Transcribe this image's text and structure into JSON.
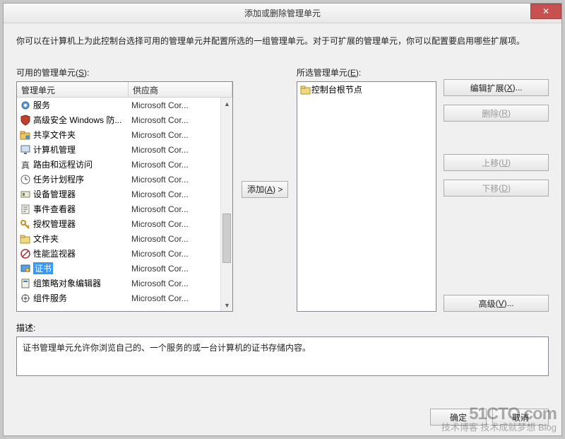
{
  "window": {
    "title": "添加或删除管理单元",
    "intro": "你可以在计算机上为此控制台选择可用的管理单元并配置所选的一组管理单元。对于可扩展的管理单元，你可以配置要启用哪些扩展项。"
  },
  "available": {
    "label_pre": "可用的管理单元",
    "hotkey": "S",
    "cols": [
      "管理单元",
      "供应商"
    ],
    "items": [
      {
        "icon": "gear-blue",
        "name": "服务",
        "vendor": "Microsoft Cor...",
        "selected": false
      },
      {
        "icon": "shield",
        "name": "高级安全 Windows 防...",
        "vendor": "Microsoft Cor...",
        "selected": false
      },
      {
        "icon": "folder-share",
        "name": "共享文件夹",
        "vendor": "Microsoft Cor...",
        "selected": false
      },
      {
        "icon": "monitor",
        "name": "计算机管理",
        "vendor": "Microsoft Cor...",
        "selected": false
      },
      {
        "icon": "router",
        "name": "路由和远程访问",
        "vendor": "Microsoft Cor...",
        "selected": false
      },
      {
        "icon": "clock",
        "name": "任务计划程序",
        "vendor": "Microsoft Cor...",
        "selected": false
      },
      {
        "icon": "device",
        "name": "设备管理器",
        "vendor": "Microsoft Cor...",
        "selected": false
      },
      {
        "icon": "event",
        "name": "事件查看器",
        "vendor": "Microsoft Cor...",
        "selected": false
      },
      {
        "icon": "key",
        "name": "授权管理器",
        "vendor": "Microsoft Cor...",
        "selected": false
      },
      {
        "icon": "folder",
        "name": "文件夹",
        "vendor": "Microsoft Cor...",
        "selected": false
      },
      {
        "icon": "perf",
        "name": "性能监视器",
        "vendor": "Microsoft Cor...",
        "selected": false
      },
      {
        "icon": "cert",
        "name": "证书",
        "vendor": "Microsoft Cor...",
        "selected": true
      },
      {
        "icon": "policy",
        "name": "组策略对象编辑器",
        "vendor": "Microsoft Cor...",
        "selected": false
      },
      {
        "icon": "component",
        "name": "组件服务",
        "vendor": "Microsoft Cor...",
        "selected": false
      }
    ]
  },
  "selected": {
    "label_pre": "所选管理单元",
    "hotkey": "E",
    "items": [
      {
        "icon": "folder",
        "name": "控制台根节点"
      }
    ]
  },
  "buttons": {
    "add_pre": "添加",
    "add_hot": "A",
    "edit_pre": "编辑扩展",
    "edit_hot": "X",
    "remove_pre": "删除",
    "remove_hot": "R",
    "up_pre": "上移",
    "up_hot": "U",
    "down_pre": "下移",
    "down_hot": "D",
    "adv_pre": "高级",
    "adv_hot": "V",
    "ok": "确定",
    "cancel": "取消"
  },
  "description": {
    "label": "描述:",
    "text": "证书管理单元允许你浏览自己的、一个服务的或一台计算机的证书存储内容。"
  },
  "watermark": {
    "line1": "51CTO.com",
    "line2": "技术博客    技术成就梦想 Blog"
  },
  "icons": {
    "gear-blue": "<svg width='16' height='16'><circle cx='8' cy='8' r='5' fill='#6aa0d8' stroke='#2a5a9a'/><circle cx='8' cy='8' r='2' fill='#fff'/></svg>",
    "shield": "<svg width='16' height='16'><path d='M8 1 L14 3 V8 C14 12 8 15 8 15 C8 15 2 12 2 8 V3 Z' fill='#c04030' stroke='#802010'/></svg>",
    "folder-share": "<svg width='16' height='16'><rect x='1' y='5' width='13' height='9' fill='#f0c860' stroke='#b08020'/><rect x='1' y='3' width='6' height='3' fill='#f0c860' stroke='#b08020'/><circle cx='11' cy='11' r='3' fill='#5090d0'/></svg>",
    "monitor": "<svg width='16' height='16'><rect x='2' y='2' width='12' height='9' fill='#d0e0f0' stroke='#607080'/><rect x='6' y='12' width='4' height='2' fill='#607080'/></svg>",
    "router": "<svg width='16' height='16'><text x='2' y='13' font-size='14' fill='#404040' font-family='serif'>真</text></svg>",
    "clock": "<svg width='16' height='16'><circle cx='8' cy='8' r='6' fill='#fff' stroke='#606060'/><path d='M8 8 L8 4 M8 8 L11 8' stroke='#303030'/></svg>",
    "device": "<svg width='16' height='16'><rect x='2' y='4' width='12' height='8' fill='#e8e8d8' stroke='#808060'/><rect x='4' y='6' width='3' height='4' fill='#808060'/></svg>",
    "event": "<svg width='16' height='16'><rect x='3' y='2' width='10' height='12' fill='#f8f8f0' stroke='#808080'/><path d='M5 5 h6 M5 8 h6 M5 11 h4' stroke='#606060'/></svg>",
    "key": "<svg width='16' height='16'><circle cx='5' cy='6' r='3' fill='none' stroke='#c09020' stroke-width='2'/><path d='M7 8 L13 14 M11 12 l2 -2' stroke='#c09020' stroke-width='2'/></svg>",
    "folder": "<svg width='16' height='16'><rect x='1' y='5' width='13' height='9' fill='#f0d880' stroke='#b09030'/><rect x='1' y='3' width='6' height='3' fill='#f0d880' stroke='#b09030'/></svg>",
    "perf": "<svg width='16' height='16'><circle cx='8' cy='8' r='6' fill='#fff' stroke='#a03030' stroke-width='1.5'/><path d='M4 12 L12 4' stroke='#a03030' stroke-width='1.5'/></svg>",
    "cert": "<svg width='16' height='16'><rect x='2' y='3' width='12' height='9' fill='#5aa0e0' stroke='#2060a0'/><circle cx='11' cy='10' r='2.5' fill='#f0c040' stroke='#b08020'/></svg>",
    "policy": "<svg width='16' height='16'><rect x='3' y='2' width='10' height='12' fill='#f0f0e8' stroke='#707060'/><rect x='5' y='4' width='6' height='2' fill='#4080c0'/></svg>",
    "component": "<svg width='16' height='16'><circle cx='8' cy='8' r='5' fill='none' stroke='#606060'/><path d='M8 2 v3 M8 11 v3 M2 8 h3 M11 8 h3' stroke='#606060'/><circle cx='8' cy='8' r='2' fill='#808080'/></svg>"
  }
}
